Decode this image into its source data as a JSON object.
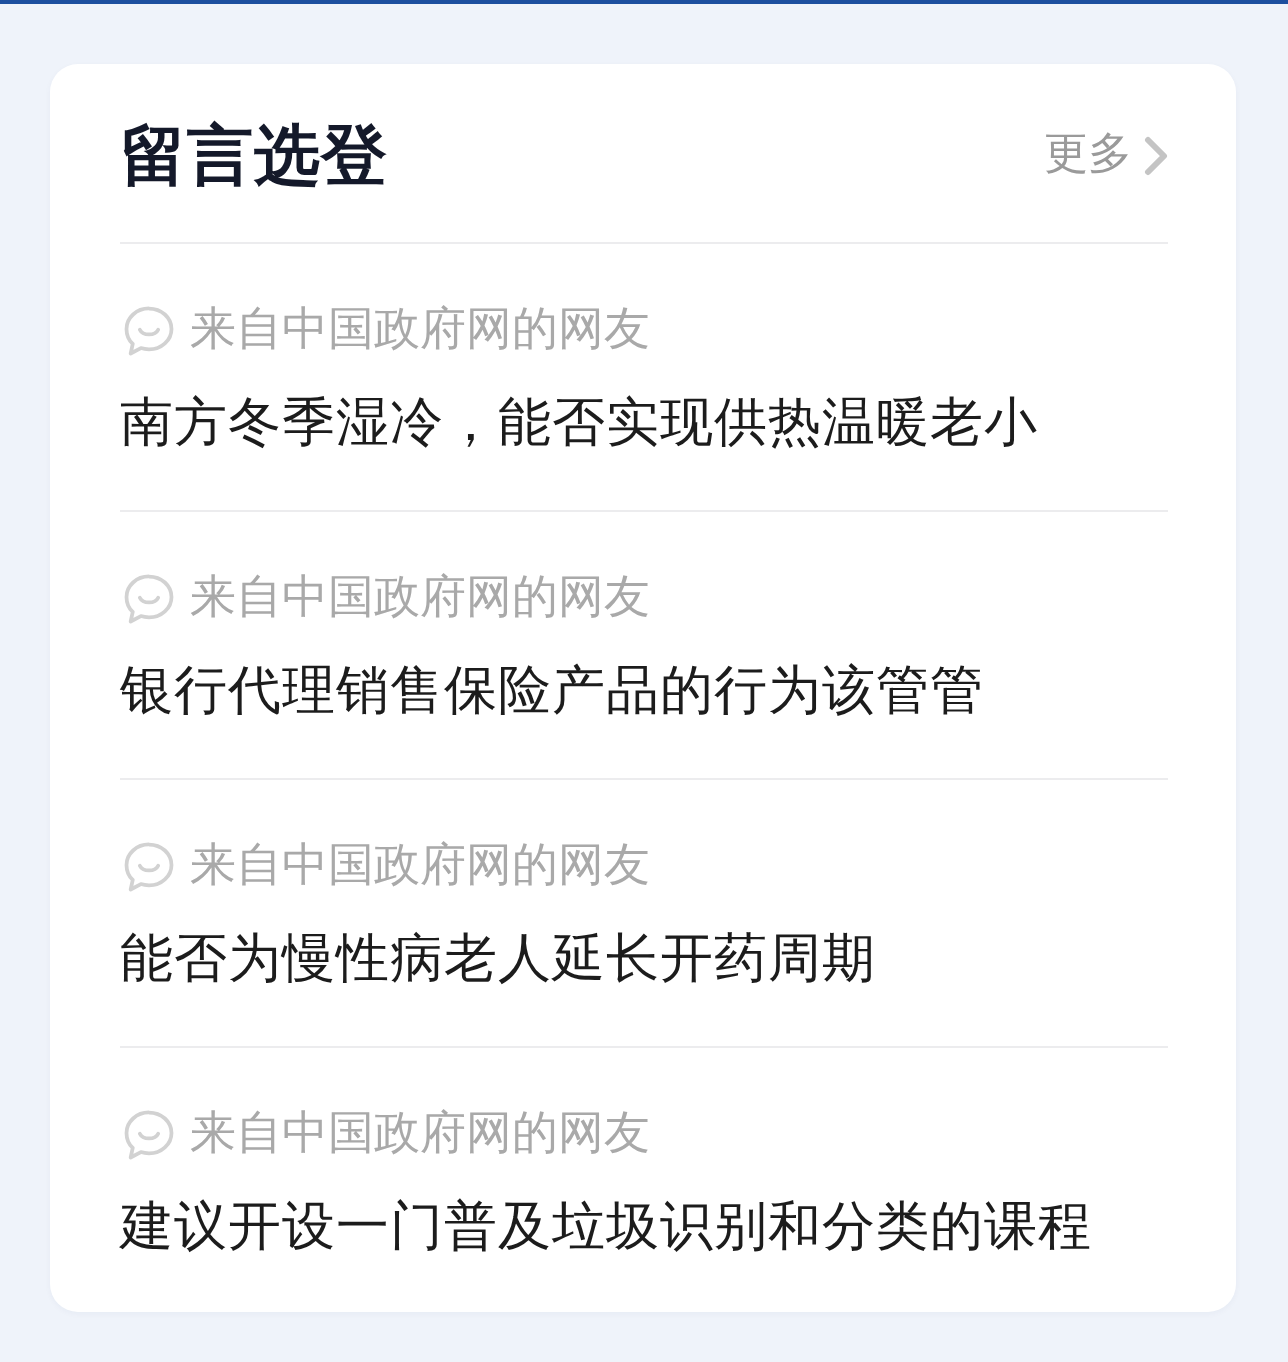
{
  "header": {
    "title": "留言选登",
    "more_link": "更多"
  },
  "messages": [
    {
      "source": "来自中国政府网的网友",
      "title": "南方冬季湿冷，能否实现供热温暖老小"
    },
    {
      "source": "来自中国政府网的网友",
      "title": "银行代理销售保险产品的行为该管管"
    },
    {
      "source": "来自中国政府网的网友",
      "title": "能否为慢性病老人延长开药周期"
    },
    {
      "source": "来自中国政府网的网友",
      "title": "建议开设一门普及垃圾识别和分类的课程"
    }
  ]
}
